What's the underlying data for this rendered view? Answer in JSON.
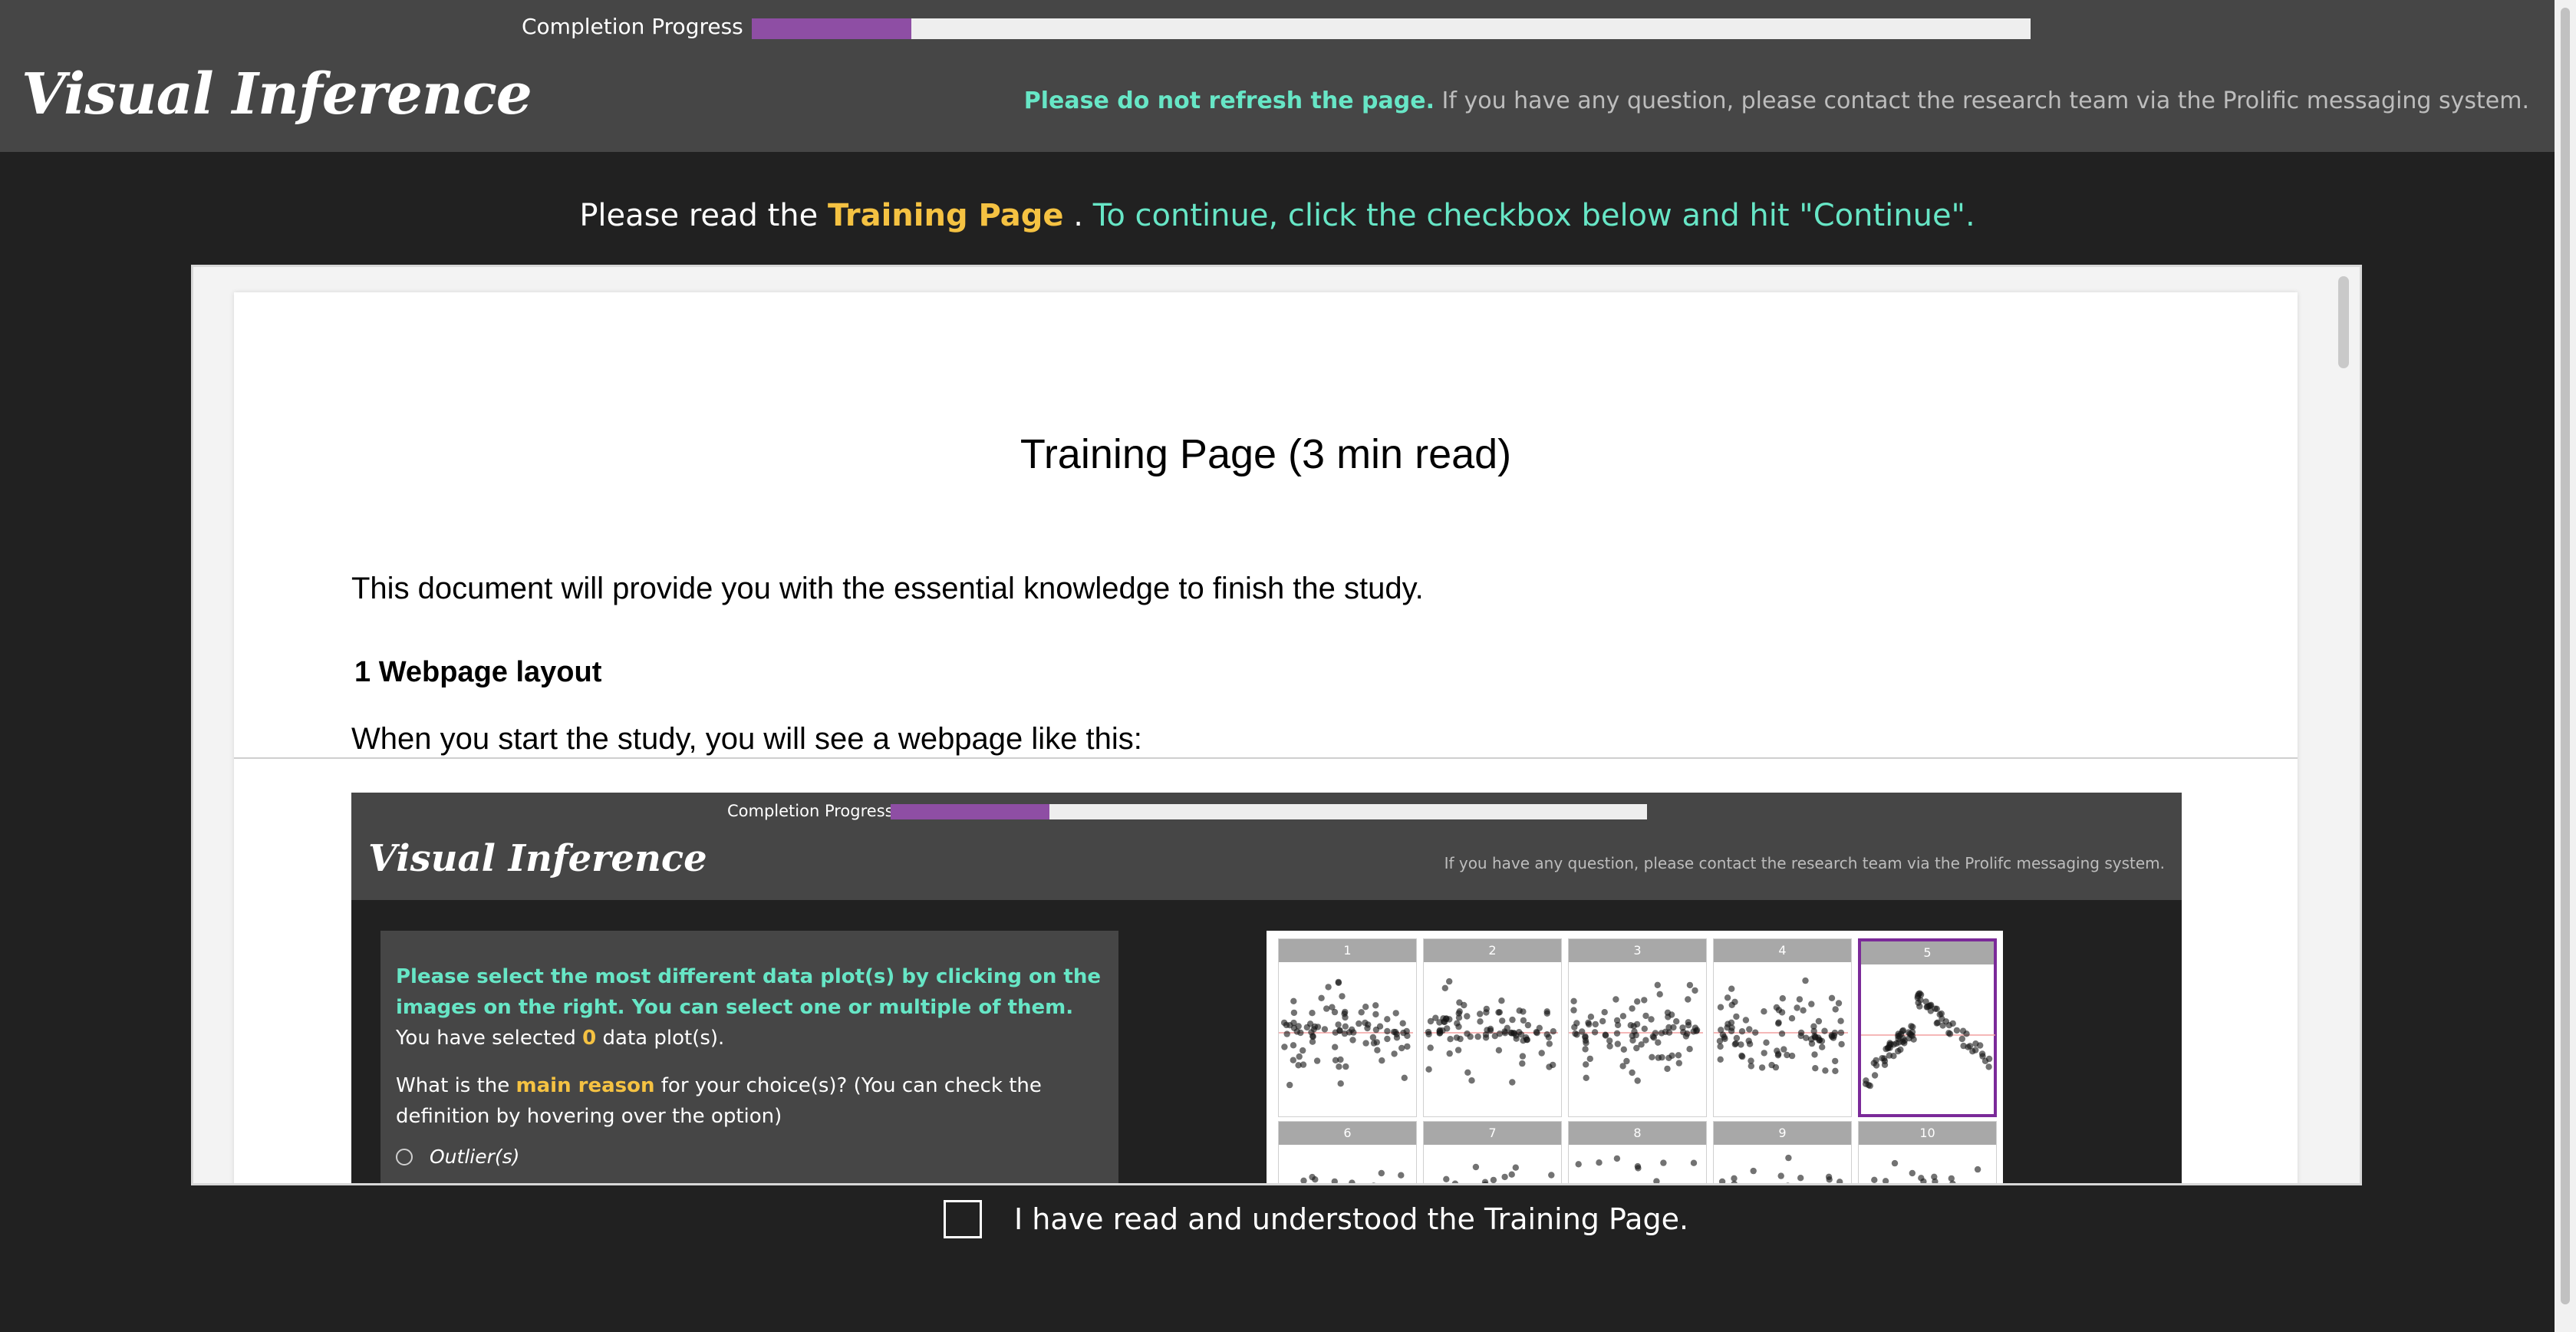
{
  "header": {
    "progress_label": "Completion Progress",
    "progress_fraction": 0.125,
    "brand": "Visual Inference",
    "notice_warning": "Please do not refresh the page.",
    "notice_text": " If you have any question, please contact the research team via the Prolific messaging system."
  },
  "instruction": {
    "prefix": "Please read the ",
    "link": "Training Page",
    "suffix": " . ",
    "action": "To continue, click the checkbox below and hit \"Continue\"."
  },
  "document": {
    "title": "Training Page (3 min read)",
    "intro": "This document will provide you with the essential knowledge to finish the study.",
    "section_heading": "1 Webpage layout",
    "section_text": "When you start the study, you will see a webpage like this:"
  },
  "screenshot": {
    "progress_label": "Completion Progress",
    "progress_fraction": 0.21,
    "brand": "Visual Inference",
    "notice": "If you have any question, please contact the research team via the Prolifc messaging system.",
    "prompt": "Please select the most different data plot(s) by clicking on the images on the right. You can select one or multiple of them.",
    "selected_prefix": "You have selected ",
    "selected_count": "0",
    "selected_suffix": " data plot(s).",
    "question_prefix": "What is the ",
    "question_highlight": "main reason",
    "question_suffix": " for your choice(s)? (You can check the definition by hovering over the option)",
    "option_first": "Outlier(s)",
    "panels": [
      "1",
      "2",
      "3",
      "4",
      "5",
      "6",
      "7",
      "8",
      "9",
      "10"
    ],
    "selected_panel": "5"
  },
  "ack": {
    "label": "I have read and understood the Training Page."
  },
  "colors": {
    "accent_purple": "#8e4ea4",
    "teal": "#67e6c6",
    "gold": "#f5c242",
    "header_bg": "#464646",
    "page_bg": "#212121"
  }
}
